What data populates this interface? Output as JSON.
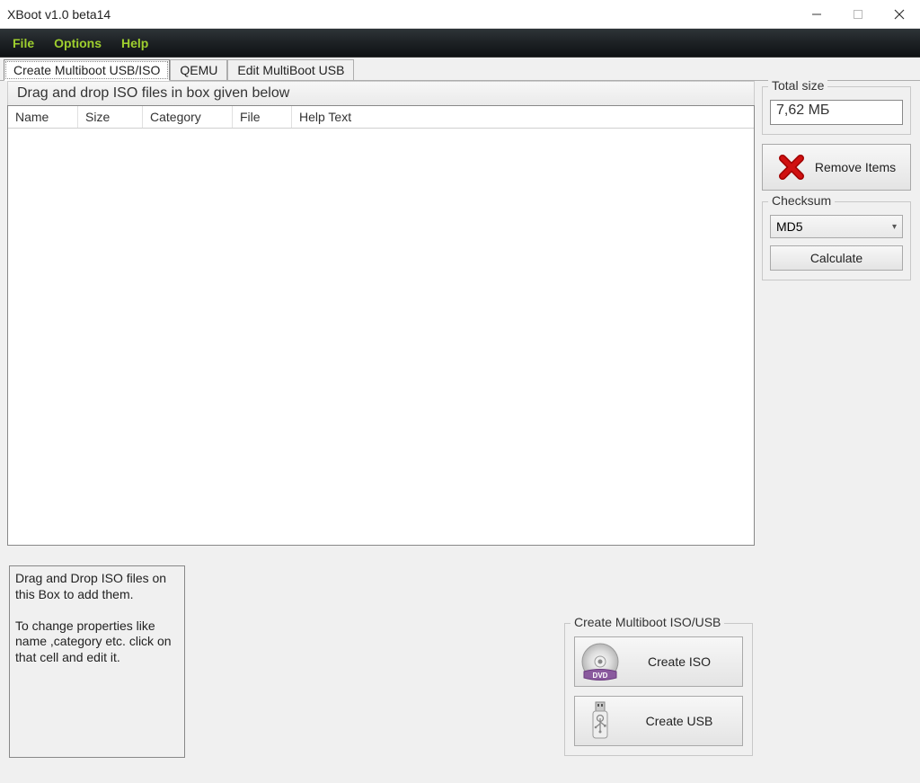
{
  "window": {
    "title": "XBoot v1.0 beta14"
  },
  "menu": {
    "file": "File",
    "options": "Options",
    "help": "Help"
  },
  "tabs": {
    "create": "Create Multiboot USB/ISO",
    "qemu": "QEMU",
    "edit": "Edit MultiBoot USB"
  },
  "main": {
    "dropHeader": "Drag and drop ISO files in box given below",
    "columns": {
      "name": "Name",
      "size": "Size",
      "category": "Category",
      "file": "File",
      "help": "Help Text"
    },
    "hint": "Drag and Drop ISO files on this Box to add them.\n\nTo change properties like name ,category etc. click on that cell and edit it."
  },
  "sidebar": {
    "totalSizeLabel": "Total size",
    "totalSizeValue": "7,62 МБ",
    "removeLabel": "Remove Items",
    "checksumLabel": "Checksum",
    "checksumSelected": "MD5",
    "calculateLabel": "Calculate"
  },
  "createGroup": {
    "title": "Create Multiboot ISO/USB",
    "isoLabel": "Create ISO",
    "usbLabel": "Create USB"
  }
}
